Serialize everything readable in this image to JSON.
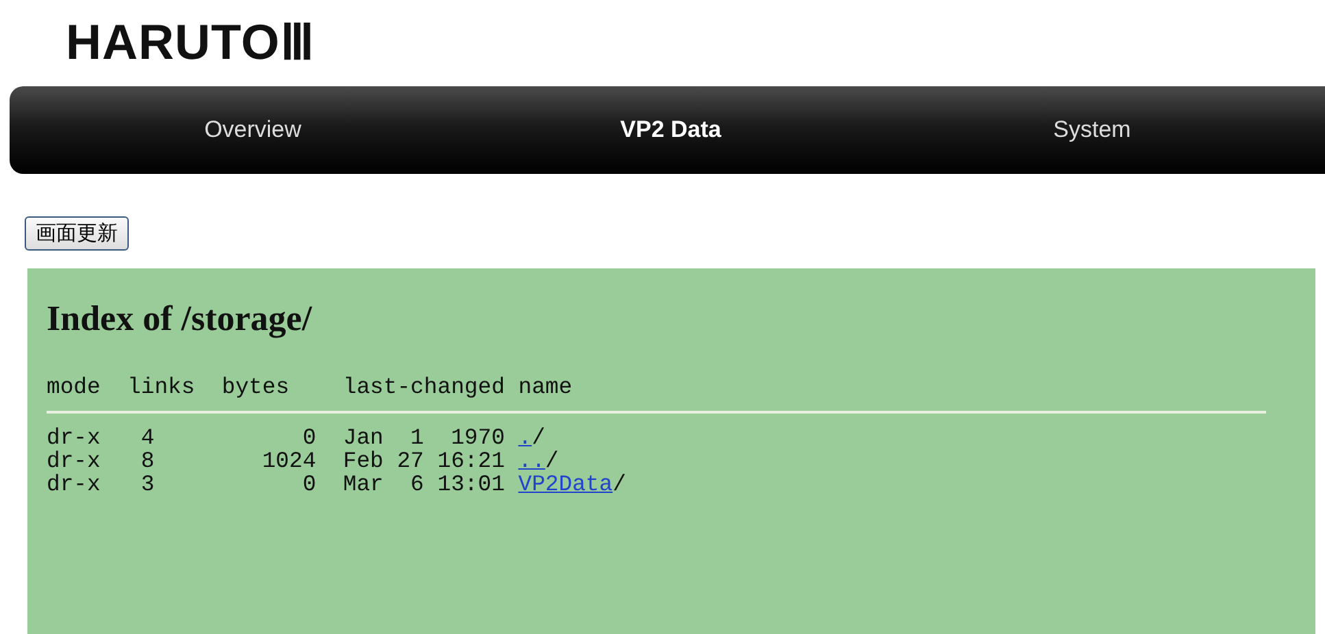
{
  "site_title": "HARUTOⅢ",
  "nav": [
    {
      "label": "Overview",
      "selected": false
    },
    {
      "label": "VP2 Data",
      "selected": true
    },
    {
      "label": "System",
      "selected": false
    }
  ],
  "refresh_button": "画面更新",
  "listing": {
    "title": "Index of /storage/",
    "columns": [
      "mode",
      "links",
      "bytes",
      "last-changed",
      "name"
    ],
    "rows": [
      {
        "mode": "dr-x",
        "links": "4",
        "bytes": "0",
        "last_changed": "Jan  1  1970",
        "name": "./"
      },
      {
        "mode": "dr-x",
        "links": "8",
        "bytes": "1024",
        "last_changed": "Feb 27 16:21",
        "name": "../"
      },
      {
        "mode": "dr-x",
        "links": "3",
        "bytes": "0",
        "last_changed": "Mar  6 13:01",
        "name": "VP2Data/"
      }
    ]
  }
}
